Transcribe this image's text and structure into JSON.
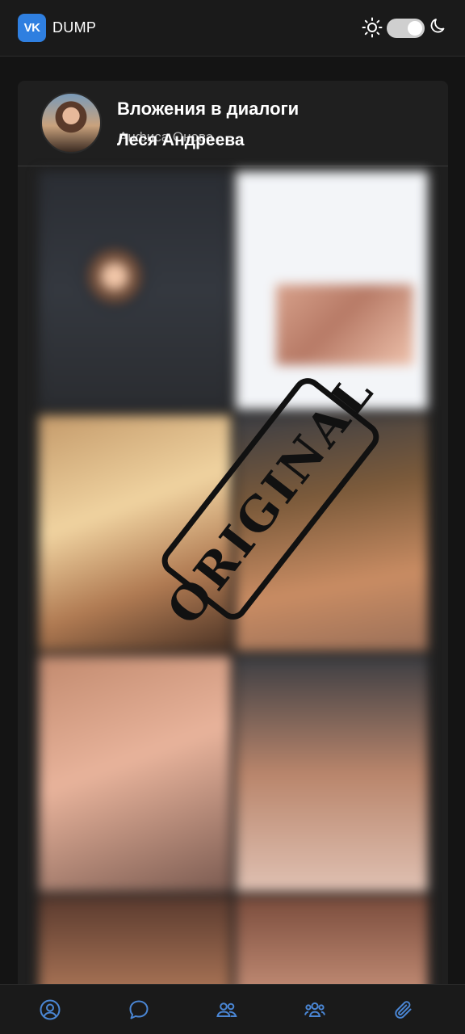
{
  "header": {
    "logo_text": "VK",
    "brand": "DUMP",
    "theme_toggle": {
      "state": "dark"
    }
  },
  "card": {
    "title": "Вложения в диалоги",
    "subtitle_overlay": "Анфиса Онова",
    "subtitle": "Леся Андреева",
    "stamp_text": "ORIGINAL"
  },
  "nav": {
    "items": [
      {
        "icon": "profile-icon"
      },
      {
        "icon": "chat-icon"
      },
      {
        "icon": "friends-icon"
      },
      {
        "icon": "groups-icon"
      },
      {
        "icon": "attachments-icon"
      }
    ]
  },
  "colors": {
    "accent": "#4a86d4",
    "vk_blue": "#2f7fe0",
    "background": "#141414",
    "card": "#1f1f1f"
  }
}
